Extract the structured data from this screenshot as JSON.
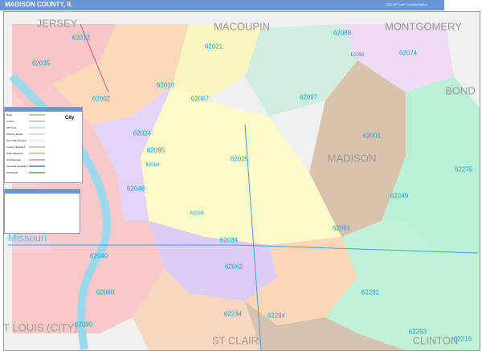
{
  "header": {
    "title": "MADISON COUNTY, IL",
    "edition": "2022 ZIP Code ColorCast Edition"
  },
  "counties": [
    "JERSEY",
    "MACOUPIN",
    "MONTGOMERY",
    "BOND",
    "MADISON",
    "Missouri",
    "ST LOUIS (CITY)",
    "ST CLAIR",
    "CLINTON"
  ],
  "zips": [
    "62012",
    "62035",
    "62021",
    "62088",
    "62058",
    "62074",
    "62002",
    "62010",
    "62067",
    "62097",
    "62024",
    "62095",
    "62084",
    "62025",
    "62001",
    "62275",
    "62048",
    "62249",
    "62026",
    "62061",
    "62034",
    "62040",
    "62062",
    "62281",
    "62060",
    "62234",
    "62294",
    "62090",
    "62293",
    "62216"
  ],
  "legend": {
    "items": [
      "State",
      "County",
      "ZIP Code",
      "Primary Streets",
      "Secondary Streets",
      "County Highways",
      "State Highways",
      "US Highways",
      "Interstate Highways",
      "Toll Roads"
    ],
    "colors": [
      "#8fe08f",
      "#c8c8e0",
      "#aee",
      "#ddd",
      "#eee",
      "#ccc",
      "#f5c08a",
      "#f59ac8",
      "#6aa0e0",
      "#6c6"
    ],
    "city_label": "City"
  },
  "colors": {
    "header": "#6a95d5",
    "zip_label": "#19a7d6",
    "county_label": "#999999"
  }
}
